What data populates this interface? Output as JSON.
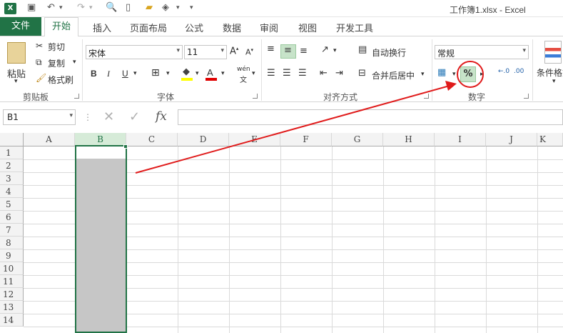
{
  "window": {
    "title": "工作簿1.xlsx - Excel",
    "logo": "X"
  },
  "tabs": [
    "文件",
    "开始",
    "插入",
    "页面布局",
    "公式",
    "数据",
    "审阅",
    "视图",
    "开发工具"
  ],
  "clipboard": {
    "paste": "粘贴",
    "cut": "剪切",
    "copy": "复制",
    "format_painter": "格式刷",
    "group": "剪贴板"
  },
  "font": {
    "name": "宋体",
    "size": "11",
    "bold": "B",
    "italic": "I",
    "underline": "U",
    "wen": "wén",
    "group": "字体"
  },
  "alignment": {
    "wrap": "自动换行",
    "merge": "合并后居中",
    "group": "对齐方式"
  },
  "number": {
    "format": "常规",
    "percent": "%",
    "group": "数字"
  },
  "styles": {
    "conditional": "条件格式"
  },
  "namebox": "B1",
  "fx": "fx",
  "columns": [
    "A",
    "B",
    "C",
    "D",
    "E",
    "F",
    "G",
    "H",
    "I",
    "J",
    "K"
  ],
  "rows": [
    "1",
    "2",
    "3",
    "4",
    "5",
    "6",
    "7",
    "8",
    "9",
    "10",
    "11",
    "12",
    "13",
    "14"
  ],
  "colors": {
    "accent": "#217346",
    "selection": "#c6c6c6",
    "annotation": "#e01b1b"
  }
}
